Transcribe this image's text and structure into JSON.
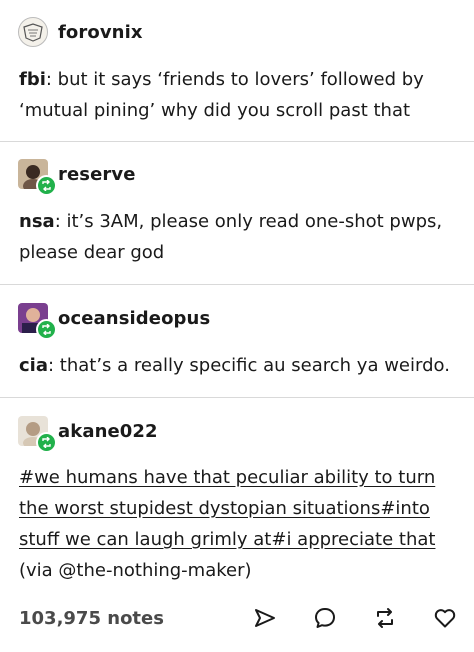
{
  "thread": [
    {
      "author": "forovnix",
      "avatar_icon": "emblem-logo-avatar",
      "reblog": false,
      "speaker": "fbi",
      "line1": ": but it says ‘friends to lovers’ followed by",
      "line2": "‘mutual pining’ why did you scroll past that"
    },
    {
      "author": "reserve",
      "avatar_icon": "photo-avatar",
      "reblog": true,
      "speaker": "nsa",
      "line1": ": it’s 3AM, please only read one-shot pwps,",
      "line2": "please dear god"
    },
    {
      "author": "oceansideopus",
      "avatar_icon": "photo-avatar",
      "reblog": true,
      "speaker": "cia",
      "line1": ": that’s a really specific au search ya weirdo."
    },
    {
      "author": "akane022",
      "avatar_icon": "photo-avatar",
      "reblog": true,
      "tags_line1": "#we humans have that peculiar ability to turn",
      "tags_line2": "the worst stupidest dystopian situations#into",
      "tags_line3": "stuff we can laugh grimly at#i appreciate that",
      "via": "(via @the-nothing-maker)"
    }
  ],
  "footer": {
    "notes": "103,975 notes",
    "actions": [
      "share-icon",
      "reply-icon",
      "reblog-icon",
      "like-icon"
    ]
  },
  "colors": {
    "reblog_badge": "#21b14b",
    "divider": "#d9d9d9",
    "text": "#1a1a1a"
  }
}
